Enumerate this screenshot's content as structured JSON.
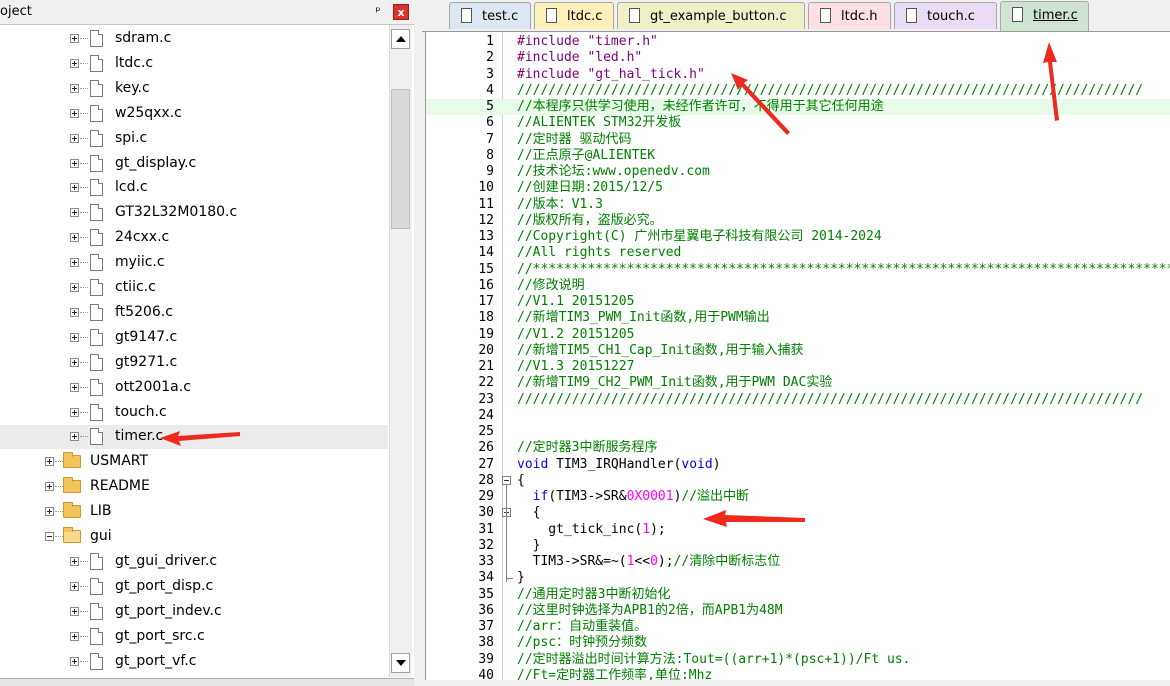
{
  "project_panel": {
    "title": "oject",
    "pin_glyph": "ᵖ",
    "close_glyph": "x",
    "tree": [
      {
        "type": "file",
        "label": "sdram.c",
        "depth": 2
      },
      {
        "type": "file",
        "label": "ltdc.c",
        "depth": 2
      },
      {
        "type": "file",
        "label": "key.c",
        "depth": 2
      },
      {
        "type": "file",
        "label": "w25qxx.c",
        "depth": 2
      },
      {
        "type": "file",
        "label": "spi.c",
        "depth": 2
      },
      {
        "type": "file",
        "label": "gt_display.c",
        "depth": 2
      },
      {
        "type": "file",
        "label": "lcd.c",
        "depth": 2
      },
      {
        "type": "file",
        "label": "GT32L32M0180.c",
        "depth": 2
      },
      {
        "type": "file",
        "label": "24cxx.c",
        "depth": 2
      },
      {
        "type": "file",
        "label": "myiic.c",
        "depth": 2
      },
      {
        "type": "file",
        "label": "ctiic.c",
        "depth": 2
      },
      {
        "type": "file",
        "label": "ft5206.c",
        "depth": 2
      },
      {
        "type": "file",
        "label": "gt9147.c",
        "depth": 2
      },
      {
        "type": "file",
        "label": "gt9271.c",
        "depth": 2
      },
      {
        "type": "file",
        "label": "ott2001a.c",
        "depth": 2
      },
      {
        "type": "file",
        "label": "touch.c",
        "depth": 2
      },
      {
        "type": "file",
        "label": "timer.c",
        "depth": 2,
        "selected": true
      },
      {
        "type": "folder",
        "label": "USMART",
        "depth": 1
      },
      {
        "type": "folder",
        "label": "README",
        "depth": 1
      },
      {
        "type": "folder",
        "label": "LIB",
        "depth": 1
      },
      {
        "type": "folder",
        "label": "gui",
        "depth": 1,
        "open": true
      },
      {
        "type": "file",
        "label": "gt_gui_driver.c",
        "depth": 2
      },
      {
        "type": "file",
        "label": "gt_port_disp.c",
        "depth": 2
      },
      {
        "type": "file",
        "label": "gt_port_indev.c",
        "depth": 2
      },
      {
        "type": "file",
        "label": "gt_port_src.c",
        "depth": 2
      },
      {
        "type": "file",
        "label": "gt_port_vf.c",
        "depth": 2
      }
    ]
  },
  "editor": {
    "tabs": [
      {
        "label": "test.c",
        "color": "#dde7f2"
      },
      {
        "label": "ltdc.c",
        "color": "#fdf0b8"
      },
      {
        "label": "gt_example_button.c",
        "color": "#eef0c6"
      },
      {
        "label": "ltdc.h",
        "color": "#fde0e4"
      },
      {
        "label": "touch.c",
        "color": "#eadcf2"
      },
      {
        "label": "timer.c",
        "color": "#cfe3d2",
        "active": true
      }
    ],
    "lines": [
      {
        "n": "1",
        "t": "#include \"timer.h\"",
        "c": "pre"
      },
      {
        "n": "2",
        "t": "#include \"led.h\"",
        "c": "pre"
      },
      {
        "n": "3",
        "t": "#include \"gt_hal_tick.h\"",
        "c": "pre"
      },
      {
        "n": "4",
        "t": "////////////////////////////////////////////////////////////////////////////////",
        "c": "comment"
      },
      {
        "n": "5",
        "t": "//本程序只供学习使用，未经作者许可，不得用于其它任何用途",
        "c": "comment",
        "hl": true
      },
      {
        "n": "6",
        "t": "//ALIENTEK STM32开发板",
        "c": "comment"
      },
      {
        "n": "7",
        "t": "//定时器 驱动代码",
        "c": "comment"
      },
      {
        "n": "8",
        "t": "//正点原子@ALIENTEK",
        "c": "comment"
      },
      {
        "n": "9",
        "t": "//技术论坛:www.openedv.com",
        "c": "comment"
      },
      {
        "n": "10",
        "t": "//创建日期:2015/12/5",
        "c": "comment"
      },
      {
        "n": "11",
        "t": "//版本：V1.3",
        "c": "comment"
      },
      {
        "n": "12",
        "t": "//版权所有，盗版必究。",
        "c": "comment"
      },
      {
        "n": "13",
        "t": "//Copyright(C) 广州市星翼电子科技有限公司 2014-2024",
        "c": "comment"
      },
      {
        "n": "14",
        "t": "//All rights reserved",
        "c": "comment"
      },
      {
        "n": "15",
        "t": "//**************************************************************************************",
        "c": "comment"
      },
      {
        "n": "16",
        "t": "//修改说明",
        "c": "comment"
      },
      {
        "n": "17",
        "t": "//V1.1 20151205",
        "c": "comment"
      },
      {
        "n": "18",
        "t": "//新增TIM3_PWM_Init函数,用于PWM输出",
        "c": "comment"
      },
      {
        "n": "19",
        "t": "//V1.2 20151205",
        "c": "comment"
      },
      {
        "n": "20",
        "t": "//新增TIM5_CH1_Cap_Init函数,用于输入捕获",
        "c": "comment"
      },
      {
        "n": "21",
        "t": "//V1.3 20151227",
        "c": "comment"
      },
      {
        "n": "22",
        "t": "//新增TIM9_CH2_PWM_Init函数,用于PWM DAC实验",
        "c": "comment"
      },
      {
        "n": "23",
        "t": "////////////////////////////////////////////////////////////////////////////////",
        "c": "comment"
      },
      {
        "n": "24",
        "t": "",
        "c": "def"
      },
      {
        "n": "25",
        "t": "",
        "c": "def"
      },
      {
        "n": "26",
        "t": "//定时器3中断服务程序",
        "c": "comment"
      },
      {
        "n": "27",
        "parts": [
          [
            "kw",
            "void"
          ],
          [
            "def",
            " TIM3_IRQHandler("
          ],
          [
            "kw",
            "void"
          ],
          [
            "def",
            ")"
          ]
        ]
      },
      {
        "n": "28",
        "t": "{",
        "c": "def",
        "fold": true
      },
      {
        "n": "29",
        "parts": [
          [
            "def",
            "  "
          ],
          [
            "kw",
            "if"
          ],
          [
            "def",
            "(TIM3->SR&"
          ],
          [
            "num",
            "0X0001"
          ],
          [
            "def",
            ")"
          ],
          [
            "comment",
            "//溢出中断"
          ]
        ]
      },
      {
        "n": "30",
        "t": "  {",
        "c": "def",
        "fold": true
      },
      {
        "n": "31",
        "parts": [
          [
            "def",
            "    gt_tick_inc("
          ],
          [
            "num",
            "1"
          ],
          [
            "def",
            ");"
          ]
        ]
      },
      {
        "n": "32",
        "t": "  }",
        "c": "def"
      },
      {
        "n": "33",
        "parts": [
          [
            "def",
            "  TIM3->SR&=~("
          ],
          [
            "num",
            "1"
          ],
          [
            "def",
            "<<"
          ],
          [
            "num",
            "0"
          ],
          [
            "def",
            ");"
          ],
          [
            "comment",
            "//清除中断标志位"
          ]
        ]
      },
      {
        "n": "34",
        "t": "}",
        "c": "def"
      },
      {
        "n": "35",
        "t": "//通用定时器3中断初始化",
        "c": "comment"
      },
      {
        "n": "36",
        "t": "//这里时钟选择为APB1的2倍，而APB1为48M",
        "c": "comment"
      },
      {
        "n": "37",
        "t": "//arr：自动重装值。",
        "c": "comment"
      },
      {
        "n": "38",
        "t": "//psc：时钟预分频数",
        "c": "comment"
      },
      {
        "n": "39",
        "t": "//定时器溢出时间计算方法:Tout=((arr+1)*(psc+1))/Ft us.",
        "c": "comment"
      },
      {
        "n": "40",
        "t": "//Ft=定时器工作频率,单位:Mhz",
        "c": "comment"
      }
    ]
  }
}
